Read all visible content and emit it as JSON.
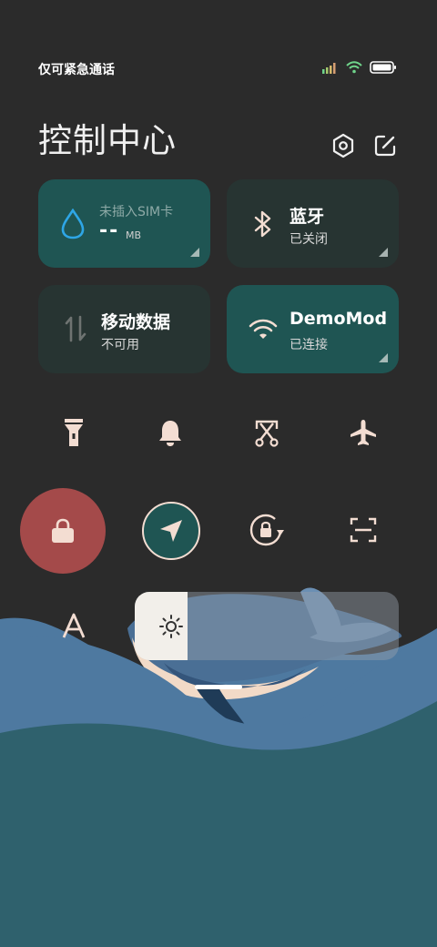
{
  "status": {
    "text": "仅可紧急通话"
  },
  "header": {
    "title": "控制中心"
  },
  "tiles": {
    "data_usage": {
      "label": "未插入SIM卡",
      "value": "--",
      "unit": "MB"
    },
    "bluetooth": {
      "label": "蓝牙",
      "status": "已关闭"
    },
    "mobile_data": {
      "label": "移动数据",
      "status": "不可用"
    },
    "wifi": {
      "label": "DemoMod",
      "status": "已连接"
    }
  },
  "colors": {
    "background": "#2b2b2b",
    "tile_active": "#1f5553",
    "tile_inactive": "#273432",
    "lock_active": "#a44a4a",
    "location_active": "#1f5553",
    "wave_light": "#4e79a0",
    "wave_dark": "#2f616d",
    "icon": "#f3ddd2"
  },
  "icons": {
    "row1": [
      "flashlight-icon",
      "bell-icon",
      "screenshot-icon",
      "airplane-icon"
    ],
    "row2": [
      "lock-icon",
      "location-icon",
      "rotation-lock-icon",
      "scan-icon"
    ],
    "row3": [
      "font-size-icon"
    ]
  },
  "brightness": {
    "level": 0.2
  }
}
